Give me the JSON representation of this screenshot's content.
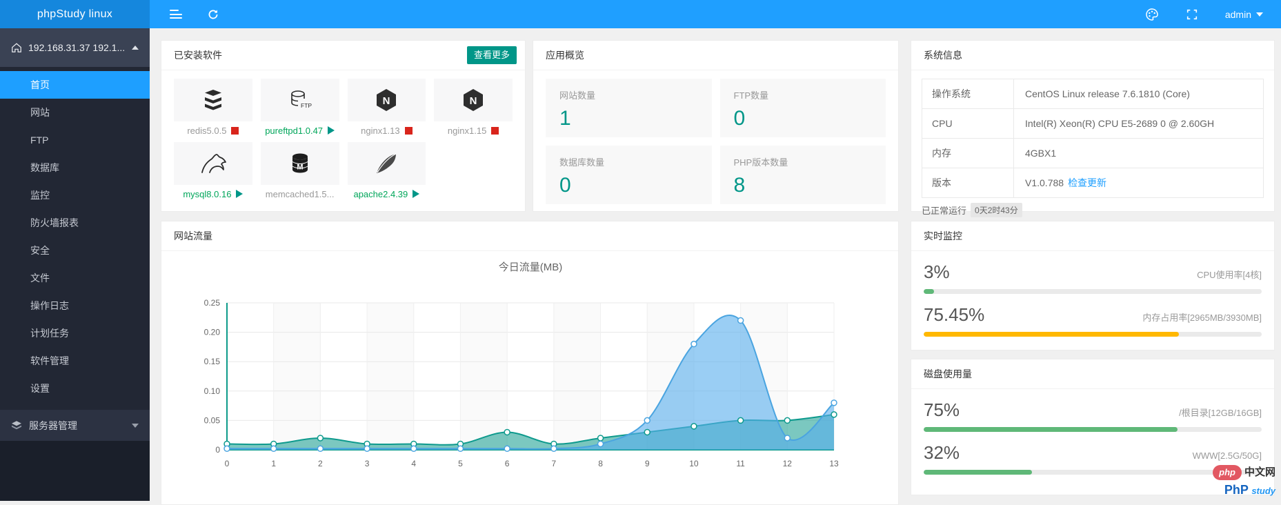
{
  "topbar": {
    "brand": "phpStudy linux",
    "admin_label": "admin"
  },
  "sidebar": {
    "server_selector": "192.168.31.37 192.1...",
    "items": [
      {
        "label": "首页",
        "active": true
      },
      {
        "label": "网站"
      },
      {
        "label": "FTP"
      },
      {
        "label": "数据库"
      },
      {
        "label": "监控"
      },
      {
        "label": "防火墙报表"
      },
      {
        "label": "安全"
      },
      {
        "label": "文件"
      },
      {
        "label": "操作日志"
      },
      {
        "label": "计划任务"
      },
      {
        "label": "软件管理"
      },
      {
        "label": "设置"
      }
    ],
    "server_mgmt_label": "服务器管理"
  },
  "panels": {
    "installed": {
      "title": "已安装软件",
      "more_label": "查看更多",
      "software": [
        {
          "name": "redis5.0.5",
          "status": "stopped"
        },
        {
          "name": "pureftpd1.0.47",
          "status": "running"
        },
        {
          "name": "nginx1.13",
          "status": "stopped"
        },
        {
          "name": "nginx1.15",
          "status": "stopped"
        },
        {
          "name": "mysql8.0.16",
          "status": "running"
        },
        {
          "name": "memcached1.5...",
          "status": "none"
        },
        {
          "name": "apache2.4.39",
          "status": "running"
        }
      ]
    },
    "overview": {
      "title": "应用概览",
      "stats": [
        {
          "label": "网站数量",
          "value": "1"
        },
        {
          "label": "FTP数量",
          "value": "0"
        },
        {
          "label": "数据库数量",
          "value": "0"
        },
        {
          "label": "PHP版本数量",
          "value": "8"
        }
      ]
    },
    "sysinfo": {
      "title": "系统信息",
      "rows": [
        {
          "label": "操作系统",
          "value": "CentOS Linux release 7.6.1810 (Core)"
        },
        {
          "label": "CPU",
          "value": "Intel(R) Xeon(R) CPU E5-2689 0 @ 2.60GH"
        },
        {
          "label": "内存",
          "value": "4GBX1"
        },
        {
          "label": "版本",
          "value": "V1.0.788"
        }
      ],
      "update_link": "检查更新",
      "uptime_label": "已正常运行",
      "uptime_value": "0天2时43分"
    },
    "traffic": {
      "title": "网站流量"
    },
    "realtime": {
      "title": "实时监控",
      "meters": [
        {
          "value": "3%",
          "label": "CPU使用率[4核]",
          "percent": 3,
          "color": "#5FB878"
        },
        {
          "value": "75.45%",
          "label": "内存占用率[2965MB/3930MB]",
          "percent": 75.45,
          "color": "#FFB800"
        }
      ]
    },
    "disk": {
      "title": "磁盘使用量",
      "meters": [
        {
          "value": "75%",
          "label": "/根目录[12GB/16GB]",
          "percent": 75,
          "color": "#5FB878"
        },
        {
          "value": "32%",
          "label": "WWW[2.5G/50G]",
          "percent": 32,
          "color": "#5FB878"
        }
      ]
    }
  },
  "chart_data": {
    "type": "area",
    "title": "今日流量(MB)",
    "x": [
      0,
      1,
      2,
      3,
      4,
      5,
      6,
      7,
      8,
      9,
      10,
      11,
      12,
      13
    ],
    "ylim": [
      0,
      0.25
    ],
    "yticks": [
      0,
      0.05,
      0.1,
      0.15,
      0.2,
      0.25
    ],
    "grid": true,
    "legend_position": "none",
    "axis_color": "#0c9b8a",
    "series": [
      {
        "name": "series-teal",
        "color": "#0e9a8d",
        "fill": "rgba(14,154,141,0.55)",
        "values": [
          0.01,
          0.01,
          0.02,
          0.01,
          0.01,
          0.01,
          0.03,
          0.01,
          0.02,
          0.03,
          0.04,
          0.05,
          0.05,
          0.06
        ]
      },
      {
        "name": "series-blue",
        "color": "#4aa4e0",
        "fill": "rgba(86,173,237,0.6)",
        "values": [
          0.002,
          0.002,
          0.002,
          0.002,
          0.002,
          0.002,
          0.002,
          0.002,
          0.01,
          0.05,
          0.18,
          0.22,
          0.02,
          0.08
        ]
      }
    ]
  },
  "watermark": {
    "badge": "php",
    "site": "中文网",
    "brand": "PhP",
    "brand_sub": "study"
  }
}
